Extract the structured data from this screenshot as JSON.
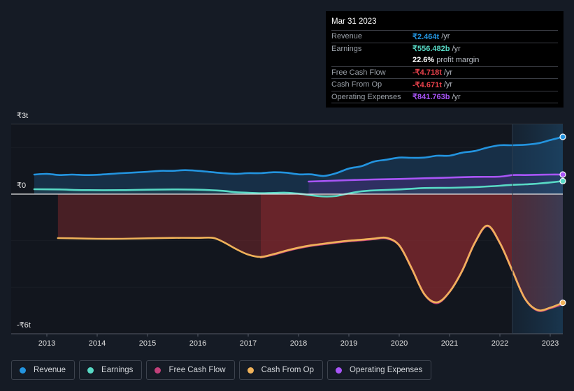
{
  "tooltip": {
    "date": "Mar 31 2023",
    "rows": [
      {
        "label": "Revenue",
        "value": "₹2.464t",
        "unit": "/yr",
        "color": "#2394df"
      },
      {
        "label": "Earnings",
        "value": "₹556.482b",
        "unit": "/yr",
        "color": "#58d9c5"
      },
      {
        "label": "",
        "value": "22.6%",
        "unit": "profit margin",
        "color": "#ffffff"
      },
      {
        "label": "Free Cash Flow",
        "value": "-₹4.718t",
        "unit": "/yr",
        "color": "#e8414b"
      },
      {
        "label": "Cash From Op",
        "value": "-₹4.671t",
        "unit": "/yr",
        "color": "#e8414b"
      },
      {
        "label": "Operating Expenses",
        "value": "₹841.763b",
        "unit": "/yr",
        "color": "#a855f7"
      }
    ]
  },
  "chart_data": {
    "type": "area",
    "title": "",
    "xlabel": "",
    "ylabel": "",
    "unit": "₹ trillion",
    "ylim": [
      -6,
      3
    ],
    "xlim": [
      2012.5,
      2023.25
    ],
    "y_ticks": [
      {
        "value": 3,
        "label": "₹3t"
      },
      {
        "value": 0,
        "label": "₹0"
      },
      {
        "value": -6,
        "label": "-₹6t"
      }
    ],
    "gridlines": [
      3,
      2,
      0,
      -2,
      -4,
      -6
    ],
    "x_ticks": [
      {
        "value": 2013,
        "label": "2013"
      },
      {
        "value": 2014,
        "label": "2014"
      },
      {
        "value": 2015,
        "label": "2015"
      },
      {
        "value": 2016,
        "label": "2016"
      },
      {
        "value": 2017,
        "label": "2017"
      },
      {
        "value": 2018,
        "label": "2018"
      },
      {
        "value": 2019,
        "label": "2019"
      },
      {
        "value": 2020,
        "label": "2020"
      },
      {
        "value": 2021,
        "label": "2021"
      },
      {
        "value": 2022,
        "label": "2022"
      },
      {
        "value": 2023,
        "label": "2023"
      }
    ],
    "highlight_range": [
      2022.25,
      2023.25
    ],
    "legend_position": "bottom-left",
    "series": [
      {
        "name": "Revenue",
        "color": "#2394df",
        "x": [
          2012.75,
          2013.0,
          2013.25,
          2013.5,
          2013.75,
          2014.0,
          2014.5,
          2015.0,
          2015.25,
          2015.5,
          2015.75,
          2016.0,
          2016.25,
          2016.5,
          2016.75,
          2017.0,
          2017.25,
          2017.5,
          2017.75,
          2018.0,
          2018.25,
          2018.5,
          2018.75,
          2019.0,
          2019.25,
          2019.5,
          2019.75,
          2020.0,
          2020.25,
          2020.5,
          2020.75,
          2021.0,
          2021.25,
          2021.5,
          2021.75,
          2022.0,
          2022.25,
          2022.5,
          2022.75,
          2023.0,
          2023.25
        ],
        "values": [
          0.84,
          0.87,
          0.82,
          0.84,
          0.82,
          0.83,
          0.9,
          0.96,
          1.0,
          1.0,
          1.03,
          1.0,
          0.95,
          0.9,
          0.87,
          0.9,
          0.9,
          0.94,
          0.92,
          0.85,
          0.85,
          0.78,
          0.9,
          1.1,
          1.2,
          1.4,
          1.48,
          1.57,
          1.56,
          1.57,
          1.65,
          1.65,
          1.78,
          1.85,
          2.0,
          2.1,
          2.1,
          2.12,
          2.18,
          2.32,
          2.46
        ]
      },
      {
        "name": "Earnings",
        "color": "#58d9c5",
        "x": [
          2012.75,
          2013.25,
          2013.75,
          2014.5,
          2015.0,
          2015.5,
          2016.0,
          2016.5,
          2016.75,
          2017.0,
          2017.25,
          2017.5,
          2017.75,
          2018.0,
          2018.25,
          2018.5,
          2018.75,
          2019.0,
          2019.25,
          2019.5,
          2020.0,
          2020.5,
          2021.0,
          2021.5,
          2022.0,
          2022.25,
          2022.5,
          2022.75,
          2023.0,
          2023.25
        ],
        "values": [
          0.21,
          0.2,
          0.17,
          0.17,
          0.19,
          0.2,
          0.19,
          0.14,
          0.08,
          0.06,
          0.04,
          0.05,
          0.06,
          0.02,
          -0.05,
          -0.1,
          -0.08,
          0.03,
          0.12,
          0.16,
          0.2,
          0.26,
          0.27,
          0.3,
          0.36,
          0.4,
          0.42,
          0.45,
          0.5,
          0.56
        ]
      },
      {
        "name": "Free Cash Flow",
        "color": "#c2407a",
        "x": [
          2017.25,
          2017.5,
          2017.75,
          2018.0,
          2018.25,
          2018.5,
          2018.75,
          2019.0,
          2019.25,
          2019.5,
          2019.75,
          2020.0,
          2020.25,
          2020.5,
          2020.75,
          2021.0,
          2021.25,
          2021.5,
          2021.75,
          2022.0,
          2022.25,
          2022.5,
          2022.75,
          2023.0,
          2023.25
        ],
        "values": [
          -2.72,
          -2.6,
          -2.45,
          -2.32,
          -2.22,
          -2.15,
          -2.08,
          -2.02,
          -1.98,
          -1.93,
          -1.9,
          -2.2,
          -3.2,
          -4.3,
          -4.68,
          -4.2,
          -3.3,
          -2.1,
          -1.37,
          -2.1,
          -3.3,
          -4.5,
          -5.0,
          -4.9,
          -4.72
        ]
      },
      {
        "name": "Cash From Op",
        "color": "#f0b25a",
        "x": [
          2013.22,
          2013.5,
          2014.0,
          2014.5,
          2015.0,
          2015.5,
          2016.0,
          2016.3,
          2016.5,
          2016.75,
          2017.0,
          2017.25,
          2017.5,
          2017.75,
          2018.0,
          2018.25,
          2018.5,
          2018.75,
          2019.0,
          2019.25,
          2019.5,
          2019.75,
          2020.0,
          2020.25,
          2020.5,
          2020.75,
          2021.0,
          2021.25,
          2021.5,
          2021.75,
          2022.0,
          2022.25,
          2022.5,
          2022.75,
          2023.0,
          2023.25
        ],
        "values": [
          -1.89,
          -1.9,
          -1.92,
          -1.92,
          -1.9,
          -1.88,
          -1.88,
          -1.88,
          -2.05,
          -2.35,
          -2.6,
          -2.7,
          -2.58,
          -2.43,
          -2.3,
          -2.2,
          -2.13,
          -2.06,
          -2.0,
          -1.96,
          -1.91,
          -1.88,
          -2.2,
          -3.2,
          -4.3,
          -4.65,
          -4.2,
          -3.3,
          -2.1,
          -1.35,
          -2.1,
          -3.3,
          -4.5,
          -4.98,
          -4.88,
          -4.67
        ]
      },
      {
        "name": "Operating Expenses",
        "color": "#a855f7",
        "x": [
          2018.2,
          2018.5,
          2019.0,
          2019.5,
          2020.0,
          2020.5,
          2021.0,
          2021.5,
          2022.0,
          2022.25,
          2022.5,
          2022.75,
          2023.0,
          2023.25
        ],
        "values": [
          0.54,
          0.56,
          0.6,
          0.63,
          0.65,
          0.68,
          0.71,
          0.74,
          0.75,
          0.82,
          0.82,
          0.83,
          0.84,
          0.84
        ]
      }
    ]
  },
  "legend": [
    {
      "label": "Revenue",
      "color": "#2394df"
    },
    {
      "label": "Earnings",
      "color": "#58d9c5"
    },
    {
      "label": "Free Cash Flow",
      "color": "#c2407a"
    },
    {
      "label": "Cash From Op",
      "color": "#f0b25a"
    },
    {
      "label": "Operating Expenses",
      "color": "#a855f7"
    }
  ]
}
